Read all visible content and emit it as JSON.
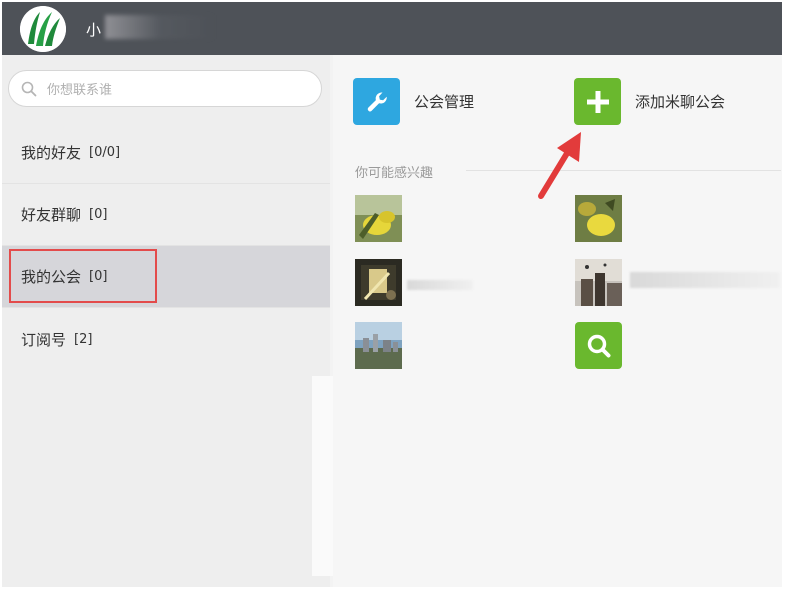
{
  "window": {
    "username": "小"
  },
  "search": {
    "placeholder": "你想联系谁"
  },
  "nav": [
    {
      "label": "我的好友",
      "count": "[0/0]"
    },
    {
      "label": "好友群聊",
      "count": "[0]"
    },
    {
      "label": "我的公会",
      "count": "[0]"
    },
    {
      "label": "订阅号",
      "count": "[2]"
    }
  ],
  "nav_selected": "我的公会",
  "actions": {
    "manage": {
      "label": "公会管理",
      "icon": "wrench-icon",
      "color": "#2ea7e0"
    },
    "add": {
      "label": "添加米聊公会",
      "icon": "plus-icon",
      "color": "#6ab82e"
    }
  },
  "recommend": {
    "title": "你可能感兴趣",
    "search_tile": {
      "icon": "search-icon",
      "color": "#6ab82e"
    }
  },
  "colors": {
    "titlebar": "#4e5258",
    "highlight": "#e34b4b",
    "arrow": "#e23b3b"
  }
}
